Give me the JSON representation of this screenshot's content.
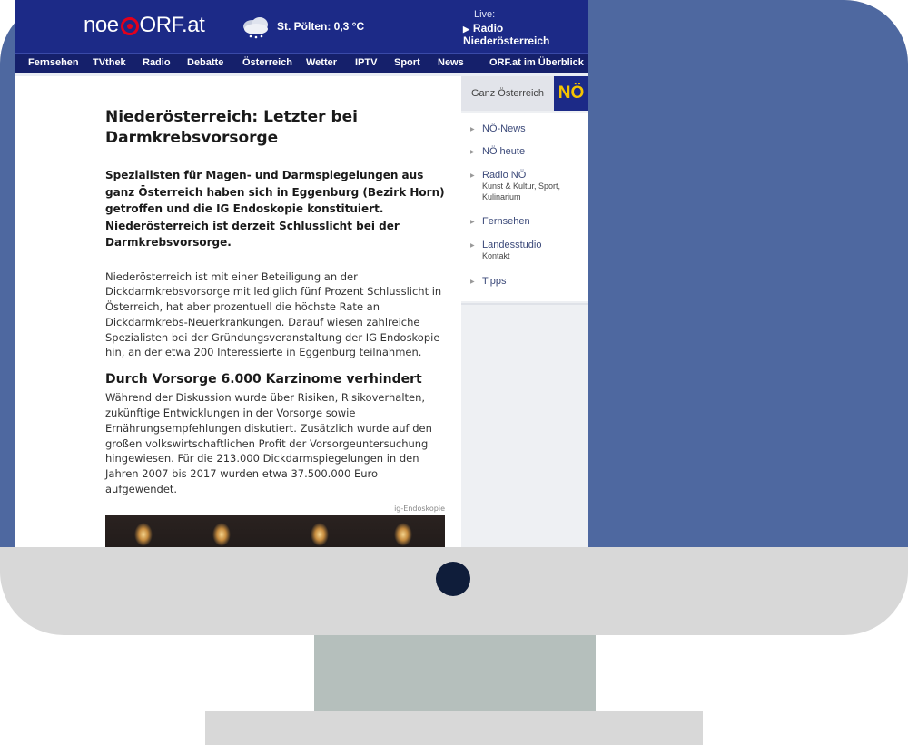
{
  "header": {
    "logo_left": "noe",
    "logo_right": "ORF.at",
    "weather": "St. Pölten: 0,3 °C",
    "live_label": "Live:",
    "live_link": "Radio Niederösterreich"
  },
  "nav": {
    "items": [
      "Fernsehen",
      "TVthek",
      "Radio",
      "Debatte",
      "Österreich",
      "Wetter",
      "IPTV",
      "Sport",
      "News",
      "ORF.at im Überblick"
    ]
  },
  "article": {
    "headline": "Niederösterreich: Letzter bei Darmkrebsvorsorge",
    "lead": "Spezialisten für Magen- und Darmspiegelungen aus ganz Österreich haben sich in Eggenburg (Bezirk Horn) getroffen und die IG Endoskopie konstituiert. Niederösterreich ist derzeit Schlusslicht bei der Darmkrebsvorsorge.",
    "paragraph1": "Niederösterreich ist mit einer Beteiligung an der Dickdarmkrebsvorsorge mit lediglich fünf Prozent Schlusslicht in Österreich, hat aber prozentuell die höchste Rate an Dickdarmkrebs-Neuerkrankungen. Darauf wiesen zahlreiche Spezialisten bei der Gründungsveranstaltung der IG Endoskopie hin, an der etwa 200 Interessierte in Eggenburg teilnahmen.",
    "subheading": "Durch Vorsorge 6.000 Karzinome verhindert",
    "paragraph2": "Während der Diskussion wurde über Risiken, Risikoverhalten, zukünftige Entwicklungen in der Vorsorge sowie Ernährungsempfehlungen diskutiert. Zusätzlich wurde auf den großen volkswirtschaftlichen Profit der Vorsorgeuntersuchung hingewiesen. Für die 213.000 Dickdarmspiegelungen in den Jahren 2007 bis 2017 wurden etwa 37.500.000 Euro aufgewendet.",
    "image_credit": "ig-Endoskopie"
  },
  "sidebar": {
    "tab_label": "Ganz Österreich",
    "badge": "NÖ",
    "items": [
      {
        "label": "NÖ-News",
        "sub": ""
      },
      {
        "label": "NÖ heute",
        "sub": ""
      },
      {
        "label": "Radio NÖ",
        "sub": "Kunst & Kultur, Sport, Kulinarium"
      },
      {
        "label": "Fernsehen",
        "sub": ""
      },
      {
        "label": "Landesstudio",
        "sub": "Kontakt"
      },
      {
        "label": "Tipps",
        "sub": ""
      }
    ]
  },
  "colors": {
    "header_bg": "#1c2a87",
    "nav_bg": "#15206b",
    "logo_accent": "#e3001b",
    "badge_text": "#f5c400",
    "screen_bg": "#4e68a0",
    "monitor_frame": "#d8d8d8",
    "stand": "#b5bfbc"
  }
}
